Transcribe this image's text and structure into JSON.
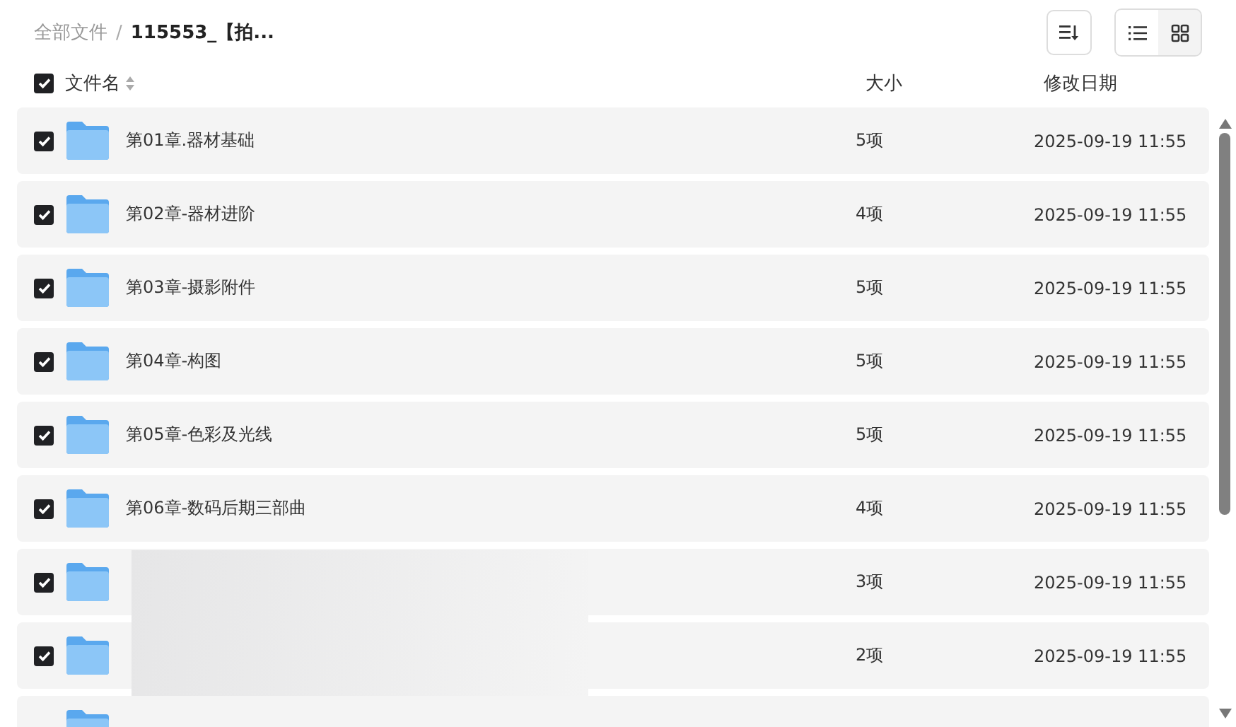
{
  "breadcrumb": [
    {
      "label": "全部文件",
      "current": false
    },
    {
      "label": "115553_【拍...",
      "current": true
    }
  ],
  "breadcrumb_separator": "/",
  "view_toggle": [
    {
      "kind": "list",
      "selected": true
    },
    {
      "kind": "grid",
      "selected": false
    }
  ],
  "header": {
    "checked": true,
    "name": "文件名",
    "size": "大小",
    "date": "修改日期"
  },
  "rows": [
    {
      "checked": true,
      "name": "第01章.器材基础",
      "size": "5项",
      "date": "2025-09-19 11:55"
    },
    {
      "checked": true,
      "name": "第02章-器材进阶",
      "size": "4项",
      "date": "2025-09-19 11:55"
    },
    {
      "checked": true,
      "name": "第03章-摄影附件",
      "size": "5项",
      "date": "2025-09-19 11:55"
    },
    {
      "checked": true,
      "name": "第04章-构图",
      "size": "5项",
      "date": "2025-09-19 11:55"
    },
    {
      "checked": true,
      "name": "第05章-色彩及光线",
      "size": "5项",
      "date": "2025-09-19 11:55"
    },
    {
      "checked": true,
      "name": "第06章-数码后期三部曲",
      "size": "4项",
      "date": "2025-09-19 11:55"
    },
    {
      "checked": true,
      "size": "3项",
      "date": "2025-09-19 11:55"
    },
    {
      "checked": true,
      "size": "2项",
      "date": "2025-09-19 11:55"
    },
    {}
  ]
}
